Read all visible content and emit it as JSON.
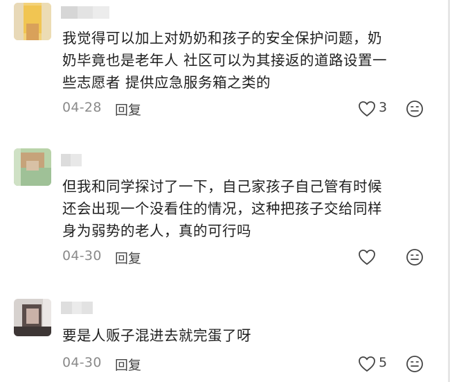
{
  "comments": [
    {
      "text_lines": [
        "我觉得可以加上对奶奶和孩子的安全保护问题，奶",
        "奶毕竟也是老年人 社区可以为其接返的道路设置一",
        "些志愿者 提供应急服务箱之类的"
      ],
      "date": "04-28",
      "reply_label": "回复",
      "like_count": "3"
    },
    {
      "text_lines": [
        "但我和同学探讨了一下，自己家孩子自己管有时候",
        "还会出现一个没看住的情况，这种把孩子交给同样",
        "身为弱势的老人，真的可行吗"
      ],
      "date": "04-30",
      "reply_label": "回复",
      "like_count": ""
    },
    {
      "text_lines": [
        "要是人贩子混进去就完蛋了呀"
      ],
      "date": "04-30",
      "reply_label": "回复",
      "like_count": "5"
    }
  ],
  "colors": {
    "text": "#1f1f1f",
    "meta": "#8a8a8a",
    "icon": "#444444"
  }
}
